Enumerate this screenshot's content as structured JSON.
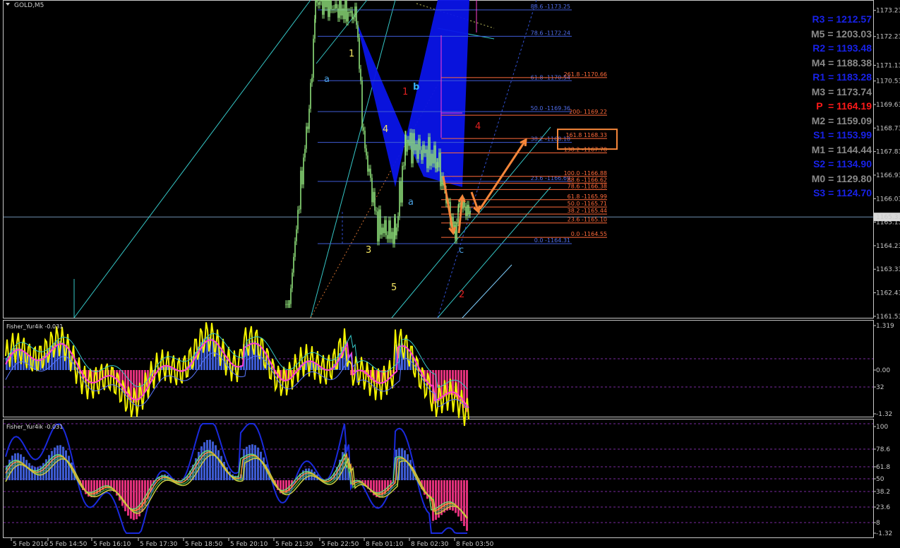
{
  "chart_title": "GOLD,M5",
  "colors": {
    "background": "#000000",
    "grid_fg": "#c8c8c8",
    "candle": "#8fe07a",
    "blue_fib": "#3f5bd6",
    "red_fib": "#ff6a3a",
    "orange": "#f5863a",
    "harmonic_fill": "#0a14e8",
    "magenta": "#ff3fd0",
    "yellow": "#f2f200",
    "cyan_line": "#35c6c6",
    "hist_pos": "#3c5ad0",
    "hist_neg": "#e0307a"
  },
  "pivots": [
    {
      "label": "R3",
      "value": "1212.57",
      "color": "#1822e8"
    },
    {
      "label": "M5",
      "value": "1203.03",
      "color": "#8a8a8a"
    },
    {
      "label": "R2",
      "value": "1193.48",
      "color": "#1822e8"
    },
    {
      "label": "M4",
      "value": "1188.38",
      "color": "#8a8a8a"
    },
    {
      "label": "R1",
      "value": "1183.28",
      "color": "#1822e8"
    },
    {
      "label": "M3",
      "value": "1173.74",
      "color": "#8a8a8a"
    },
    {
      "label": "P",
      "value": "1164.19",
      "color": "#ff1a1a"
    },
    {
      "label": "M2",
      "value": "1159.09",
      "color": "#8a8a8a"
    },
    {
      "label": "S1",
      "value": "1153.99",
      "color": "#1822e8"
    },
    {
      "label": "M1",
      "value": "1144.44",
      "color": "#8a8a8a"
    },
    {
      "label": "S2",
      "value": "1134.90",
      "color": "#1822e8"
    },
    {
      "label": "M0",
      "value": "1129.80",
      "color": "#8a8a8a"
    },
    {
      "label": "S3",
      "value": "1124.70",
      "color": "#1822e8"
    }
  ],
  "chart_data": [
    {
      "type": "candlestick",
      "title": "GOLD,M5",
      "ylim": [
        1161.5,
        1173.6
      ],
      "price_axis_ticks": [
        "1173.23",
        "1172.23",
        "1171.13",
        "1170.53",
        "1169.63",
        "1168.73",
        "1167.83",
        "1166.93",
        "1166.03",
        "1165.13",
        "1164.23",
        "1163.33",
        "1162.43",
        "1161.53"
      ],
      "current_price": "1165.33",
      "time_axis_ticks": [
        "5 Feb 2016",
        "5 Feb 14:50",
        "5 Feb 16:10",
        "5 Feb 17:30",
        "5 Feb 18:50",
        "5 Feb 20:10",
        "5 Feb 21:30",
        "5 Feb 22:50",
        "8 Feb 01:10",
        "8 Feb 02:30",
        "8 Feb 03:50"
      ],
      "blue_fib_levels": [
        {
          "text": "88.6 -1173.25",
          "price": 1173.25
        },
        {
          "text": "78.6 -1172.24",
          "price": 1172.24
        },
        {
          "text": "61.8 -1170.54",
          "price": 1170.54
        },
        {
          "text": "50.0 -1169.36",
          "price": 1169.36
        },
        {
          "text": "38.2 -1168.18",
          "price": 1168.18
        },
        {
          "text": "23.6 -1166.69",
          "price": 1166.69
        },
        {
          "text": "0.0 -1164.31",
          "price": 1164.31
        }
      ],
      "red_fib_levels": [
        {
          "text": "261.8 -1170.66",
          "price": 1170.66
        },
        {
          "text": "200- 1169.22",
          "price": 1169.22
        },
        {
          "text": "161.8 1168.33",
          "price": 1168.33
        },
        {
          "text": "138.2 -1167.78",
          "price": 1167.78
        },
        {
          "text": "100.0 -1166.88",
          "price": 1166.88
        },
        {
          "text": "88.6 -1166.62",
          "price": 1166.62
        },
        {
          "text": "78.6 -1166.38",
          "price": 1166.38
        },
        {
          "text": "61.8 -1165.99",
          "price": 1165.99
        },
        {
          "text": "50.0 -1165.71",
          "price": 1165.71
        },
        {
          "text": "38.2 -1165.44",
          "price": 1165.44
        },
        {
          "text": "23.6 -1165.10",
          "price": 1165.1
        },
        {
          "text": "0.0 -1164.55",
          "price": 1164.55
        }
      ],
      "wave_labels": [
        {
          "text": "1",
          "color": "#f5e663"
        },
        {
          "text": "a",
          "color": "#4aa0e0"
        },
        {
          "text": "1",
          "color": "#e02020"
        },
        {
          "text": "b",
          "color": "#36b0ff"
        },
        {
          "text": "4",
          "color": "#f5e663"
        },
        {
          "text": "4",
          "color": "#e02020"
        },
        {
          "text": "a",
          "color": "#4aa0e0"
        },
        {
          "text": "3",
          "color": "#f5e663"
        },
        {
          "text": "c",
          "color": "#4aa0e0"
        },
        {
          "text": "5",
          "color": "#f5e663"
        },
        {
          "text": "2",
          "color": "#e02020"
        }
      ]
    },
    {
      "type": "line",
      "title": "Fisher_Yur4ik -0.031",
      "ylim": [
        -1.32,
        1.319
      ],
      "axis_ticks": [
        "1.319",
        "0.00",
        "32",
        "-1.32"
      ]
    },
    {
      "type": "line",
      "title": "Fisher_Yur4ik -0.031",
      "ylim": [
        0,
        100
      ],
      "axis_ticks": [
        "100",
        "78.6",
        "61.8",
        "50",
        "38.2",
        "23.6",
        "8",
        "-1.32"
      ]
    }
  ]
}
